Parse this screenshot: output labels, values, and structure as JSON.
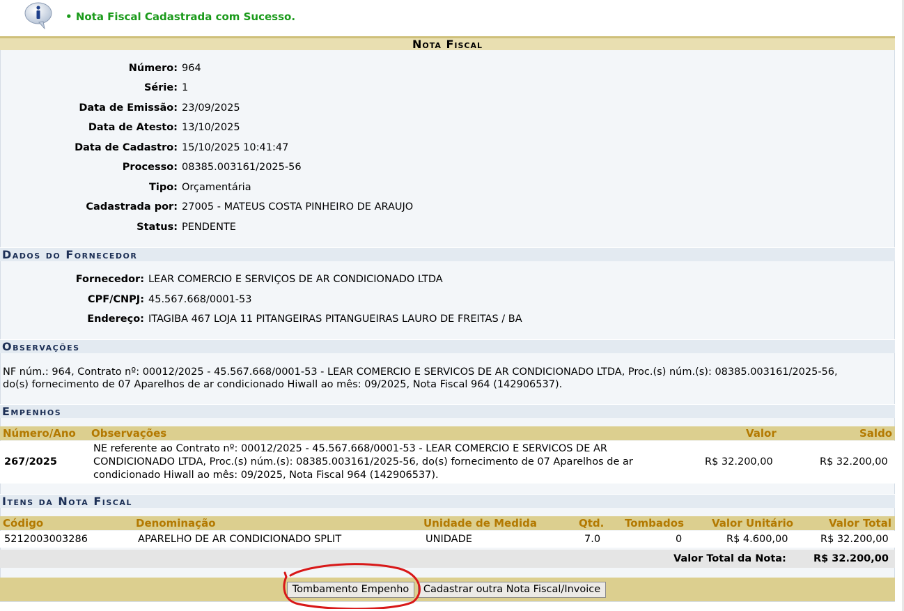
{
  "message": {
    "text": "Nota Fiscal Cadastrada com Sucesso."
  },
  "caption": "Nota Fiscal",
  "nota": [
    {
      "label": "Número:",
      "value": "964"
    },
    {
      "label": "Série:",
      "value": "1"
    },
    {
      "label": "Data de Emissão:",
      "value": "23/09/2025"
    },
    {
      "label": "Data de Atesto:",
      "value": "13/10/2025"
    },
    {
      "label": "Data de Cadastro:",
      "value": "15/10/2025 10:41:47"
    },
    {
      "label": "Processo:",
      "value": "08385.003161/2025-56"
    },
    {
      "label": "Tipo:",
      "value": "Orçamentária"
    },
    {
      "label": "Cadastrada por:",
      "value": "27005 - MATEUS COSTA PINHEIRO DE ARAUJO"
    },
    {
      "label": "Status:",
      "value": "PENDENTE"
    }
  ],
  "fornecedor": {
    "title": "Dados do Fornecedor",
    "rows": [
      {
        "label": "Fornecedor:",
        "value": "LEAR COMERCIO E SERVIÇOS DE AR CONDICIONADO LTDA"
      },
      {
        "label": "CPF/CNPJ:",
        "value": "45.567.668/0001-53"
      },
      {
        "label": "Endereço:",
        "value": "ITAGIBA 467 LOJA 11 PITANGEIRAS PITANGUEIRAS LAURO DE FREITAS / BA"
      }
    ]
  },
  "observacoes": {
    "title": "Observações",
    "line1": "NF núm.: 964, Contrato nº: 00012/2025 - 45.567.668/0001-53 - LEAR COMERCIO E SERVICOS DE AR CONDICIONADO LTDA, Proc.(s) núm.(s): 08385.003161/2025-56,",
    "line2": "do(s) fornecimento de 07 Aparelhos de ar condicionado Hiwall ao mês: 09/2025, Nota Fiscal 964 (142906537)."
  },
  "empenhos": {
    "title": "Empenhos",
    "headers": {
      "numero": "Número/Ano",
      "obs": "Observações",
      "valor": "Valor",
      "saldo": "Saldo"
    },
    "row": {
      "numero": "267/2025",
      "obs1": "NE referente ao Contrato nº: 00012/2025 - 45.567.668/0001-53 - LEAR COMERCIO E SERVICOS DE AR",
      "obs2": "CONDICIONADO LTDA, Proc.(s) núm.(s): 08385.003161/2025-56, do(s) fornecimento de 07 Aparelhos de ar",
      "obs3": "condicionado Hiwall ao mês: 09/2025, Nota Fiscal 964 (142906537).",
      "valor": "R$ 32.200,00",
      "saldo": "R$ 32.200,00"
    }
  },
  "itens": {
    "title": "Itens da Nota Fiscal",
    "headers": {
      "codigo": "Código",
      "denominacao": "Denominação",
      "unidade": "Unidade de Medida",
      "qtd": "Qtd.",
      "tombados": "Tombados",
      "unitario": "Valor Unitário",
      "total": "Valor Total"
    },
    "row": {
      "codigo": "5212003003286",
      "denominacao": "APARELHO DE AR CONDICIONADO SPLIT",
      "unidade": "UNIDADE",
      "qtd": "7.0",
      "tombados": "0",
      "unitario": "R$ 4.600,00",
      "total": "R$ 32.200,00"
    },
    "total_label": "Valor Total da Nota:",
    "total_value": "R$ 32.200,00"
  },
  "buttons": {
    "tombamento": "Tombamento Empenho",
    "cadastrar": "Cadastrar outra Nota Fiscal/Invoice"
  },
  "colors": {
    "success": "#1a9a1a",
    "caption_bg": "#e9dfb1",
    "table_header_text": "#b37900",
    "annotation": "#d81818"
  }
}
